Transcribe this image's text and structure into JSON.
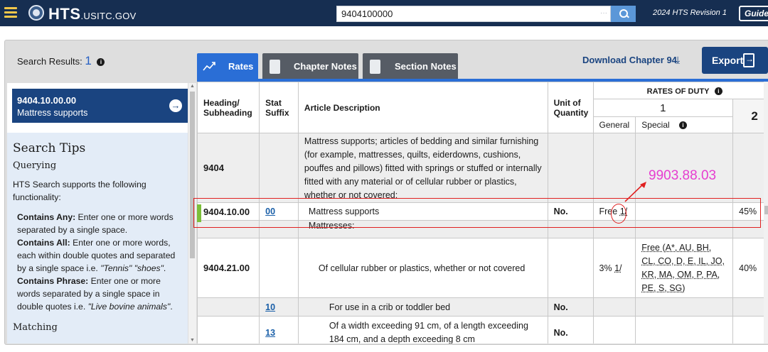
{
  "header": {
    "brand": "HTS",
    "brand_sub": ".USITC.GOV",
    "search_value": "9404100000",
    "revision": "2024 HTS Revision 1",
    "guide_label": "Guide"
  },
  "toolbar": {
    "results_label": "Search Results:",
    "results_count": "1",
    "tabs": [
      {
        "label": "Rates",
        "active": true
      },
      {
        "label": "Chapter Notes",
        "active": false
      },
      {
        "label": "Section Notes",
        "active": false
      }
    ],
    "download_label": "Download Chapter 94",
    "export_label": "Export"
  },
  "sidebar": {
    "result": {
      "number": "9404.10.00.00",
      "description": "Mattress supports"
    },
    "tips": {
      "title": "Search Tips",
      "querying": "Querying",
      "intro": "HTS Search supports the following functionality:",
      "items": [
        {
          "term": "Contains Any:",
          "text": " Enter one or more words separated by a single space."
        },
        {
          "term": "Contains All:",
          "text": " Enter one or more words, each within double quotes and separated by a single space i.e. ",
          "example": "\"Tennis\" \"shoes\"",
          "tail": "."
        },
        {
          "term": "Contains Phrase:",
          "text": " Enter one or more words separated by a single space in double quotes i.e. ",
          "example": "\"Live bovine animals\"",
          "tail": "."
        }
      ],
      "matching": "Matching"
    }
  },
  "table": {
    "headers": {
      "heading": "Heading/ Subheading",
      "stat": "Stat Suffix",
      "description": "Article Description",
      "unit": "Unit of Quantity",
      "rates_of_duty": "RATES OF DUTY",
      "col1": "1",
      "general": "General",
      "special": "Special",
      "col2": "2"
    },
    "rows": [
      {
        "heading": "9404",
        "stat": "",
        "description": "Mattress supports; articles of bedding and similar furnishing (for example, mattresses, quilts, eiderdowns, cushions, pouffes and pillows) fitted with springs or stuffed or internally fitted with any material or of cellular rubber or plastics, whether or not covered:",
        "unit": "",
        "general": "",
        "special": "",
        "col2": ""
      },
      {
        "heading": "9404.10.00",
        "stat": "00",
        "description": "Mattress supports",
        "unit": "No.",
        "general": "Free",
        "general_note": "1/",
        "special": "",
        "col2": "45%"
      },
      {
        "heading": "",
        "stat": "",
        "description": "Mattresses:",
        "unit": "",
        "general": "",
        "special": "",
        "col2": ""
      },
      {
        "heading": "9404.21.00",
        "stat": "",
        "description": "Of cellular rubber or plastics, whether or not covered",
        "unit": "",
        "general": "3%",
        "general_note": "1/",
        "special": "Free (A*, AU, BH, CL, CO, D, E, IL, JO, KR, MA, OM, P, PA, PE, S, SG)",
        "col2": "40%"
      },
      {
        "heading": "",
        "stat": "10",
        "description": "For use in a crib or toddler bed",
        "unit": "No.",
        "general": "",
        "special": "",
        "col2": ""
      },
      {
        "heading": "",
        "stat": "13",
        "description": "Of a width exceeding 91 cm, of a length exceeding 184 cm, and a depth exceeding 8 cm",
        "unit": "No.",
        "general": "",
        "special": "",
        "col2": ""
      }
    ]
  },
  "annotation": {
    "label": "9903.88.03",
    "color": "#e63dd0",
    "mark_color": "#e02020"
  },
  "colors": {
    "topbar": "#162e51",
    "primary": "#1a4480",
    "tab_active": "#2a6ed6",
    "tab_inactive": "#565c65",
    "accent_bar": "#7bbf3a",
    "tips_bg": "#e3ecf7"
  }
}
